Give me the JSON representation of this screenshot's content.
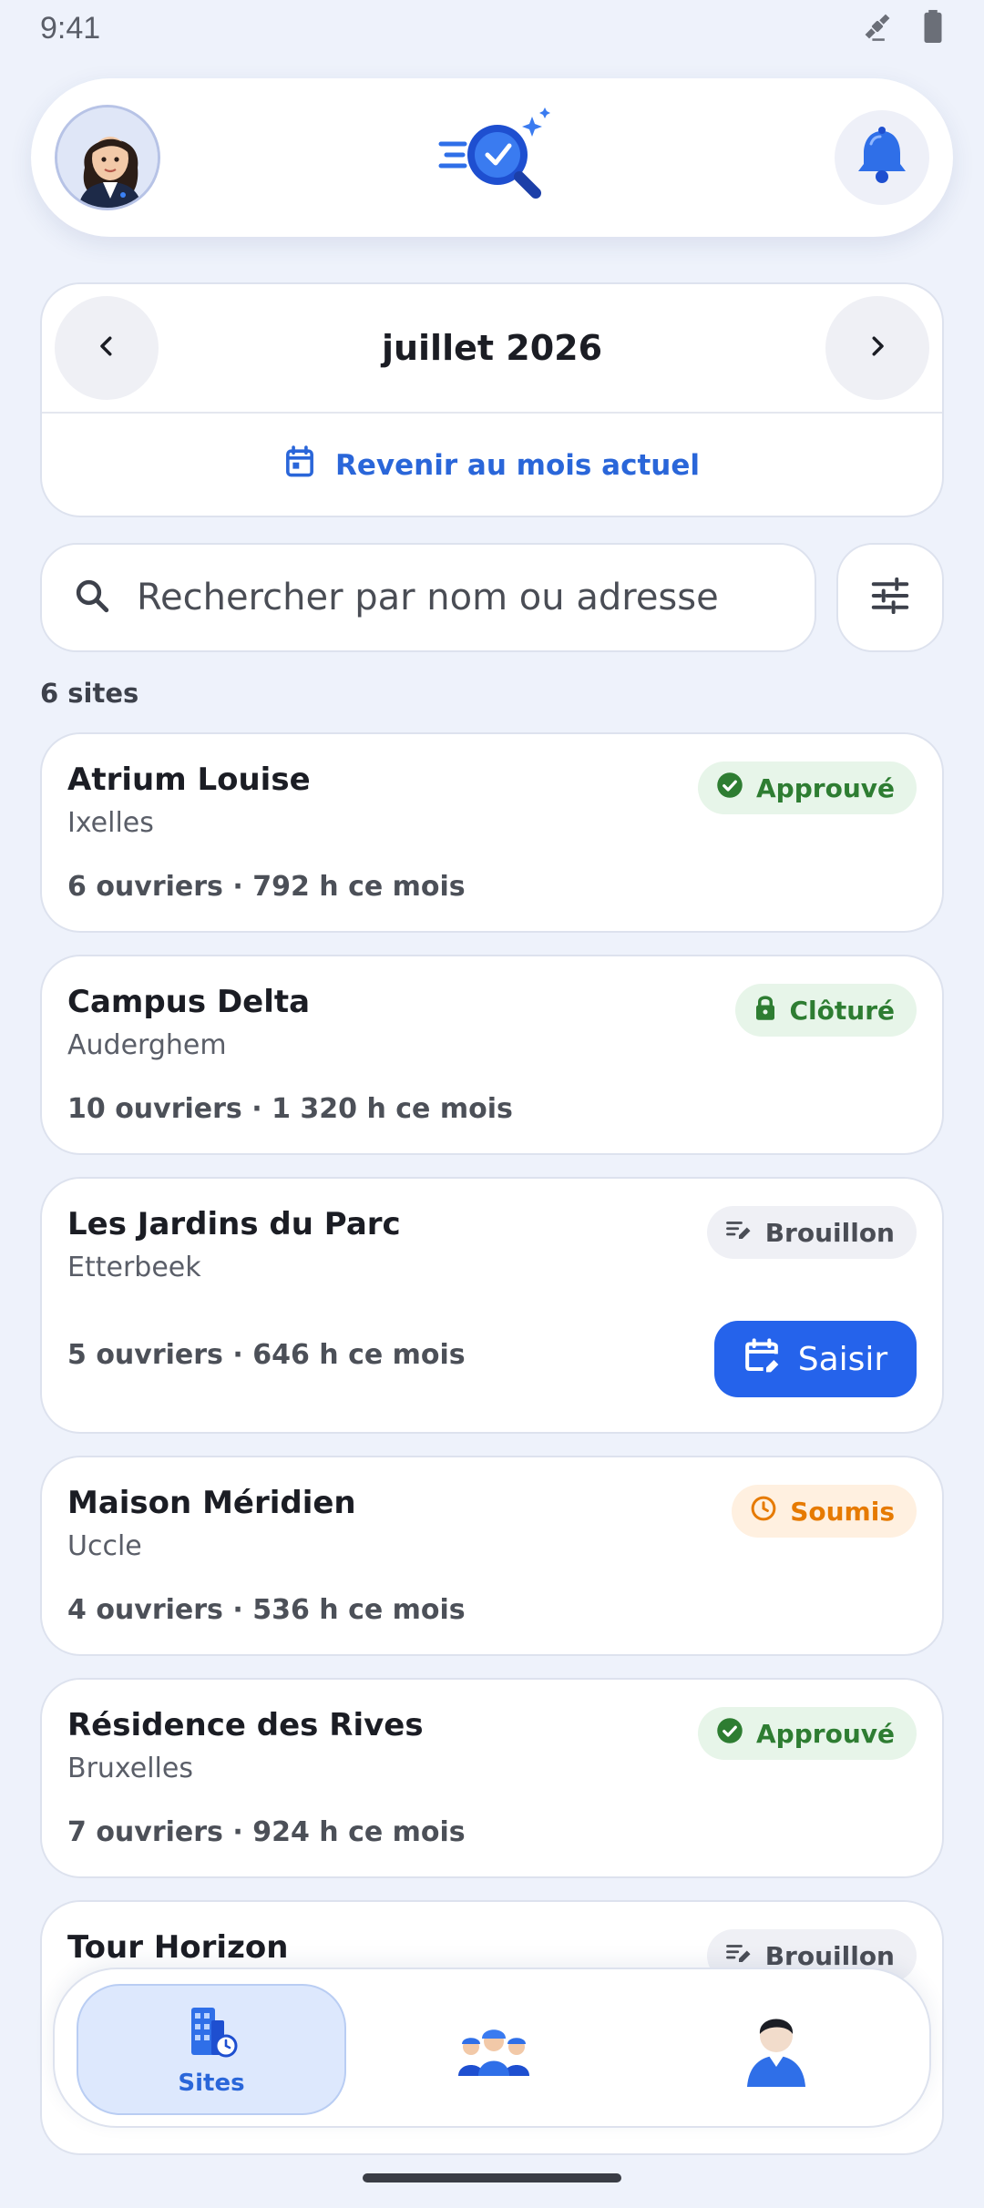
{
  "status_bar": {
    "time": "9:41"
  },
  "month_nav": {
    "month_label": "juillet 2026",
    "back_to_current": "Revenir au mois actuel"
  },
  "search": {
    "placeholder": "Rechercher par nom ou adresse"
  },
  "results": {
    "count_label": "6 sites"
  },
  "sites": [
    {
      "name": "Atrium Louise",
      "city": "Ixelles",
      "stats": "6 ouvriers · 792 h ce mois",
      "status": "Approuvé",
      "status_kind": "approved"
    },
    {
      "name": "Campus Delta",
      "city": "Auderghem",
      "stats": "10 ouvriers · 1 320 h ce mois",
      "status": "Clôturé",
      "status_kind": "closed"
    },
    {
      "name": "Les Jardins du Parc",
      "city": "Etterbeek",
      "stats": "5 ouvriers · 646 h ce mois",
      "status": "Brouillon",
      "status_kind": "draft",
      "action_label": "Saisir"
    },
    {
      "name": "Maison Méridien",
      "city": "Uccle",
      "stats": "4 ouvriers · 536 h ce mois",
      "status": "Soumis",
      "status_kind": "submitted"
    },
    {
      "name": "Résidence des Rives",
      "city": "Bruxelles",
      "stats": "7 ouvriers · 924 h ce mois",
      "status": "Approuvé",
      "status_kind": "approved"
    },
    {
      "name": "Tour Horizon",
      "city": "",
      "stats": "",
      "status": "Brouillon",
      "status_kind": "draft"
    }
  ],
  "bottom_nav": {
    "items": [
      {
        "label": "Sites",
        "icon": "building-icon",
        "active": true
      },
      {
        "label": "",
        "icon": "team-icon",
        "active": false
      },
      {
        "label": "",
        "icon": "profile-icon",
        "active": false
      }
    ]
  },
  "colors": {
    "accent": "#2563eb",
    "approved": "#2e7d32",
    "submitted": "#e67a00",
    "background": "#eef2fb"
  }
}
